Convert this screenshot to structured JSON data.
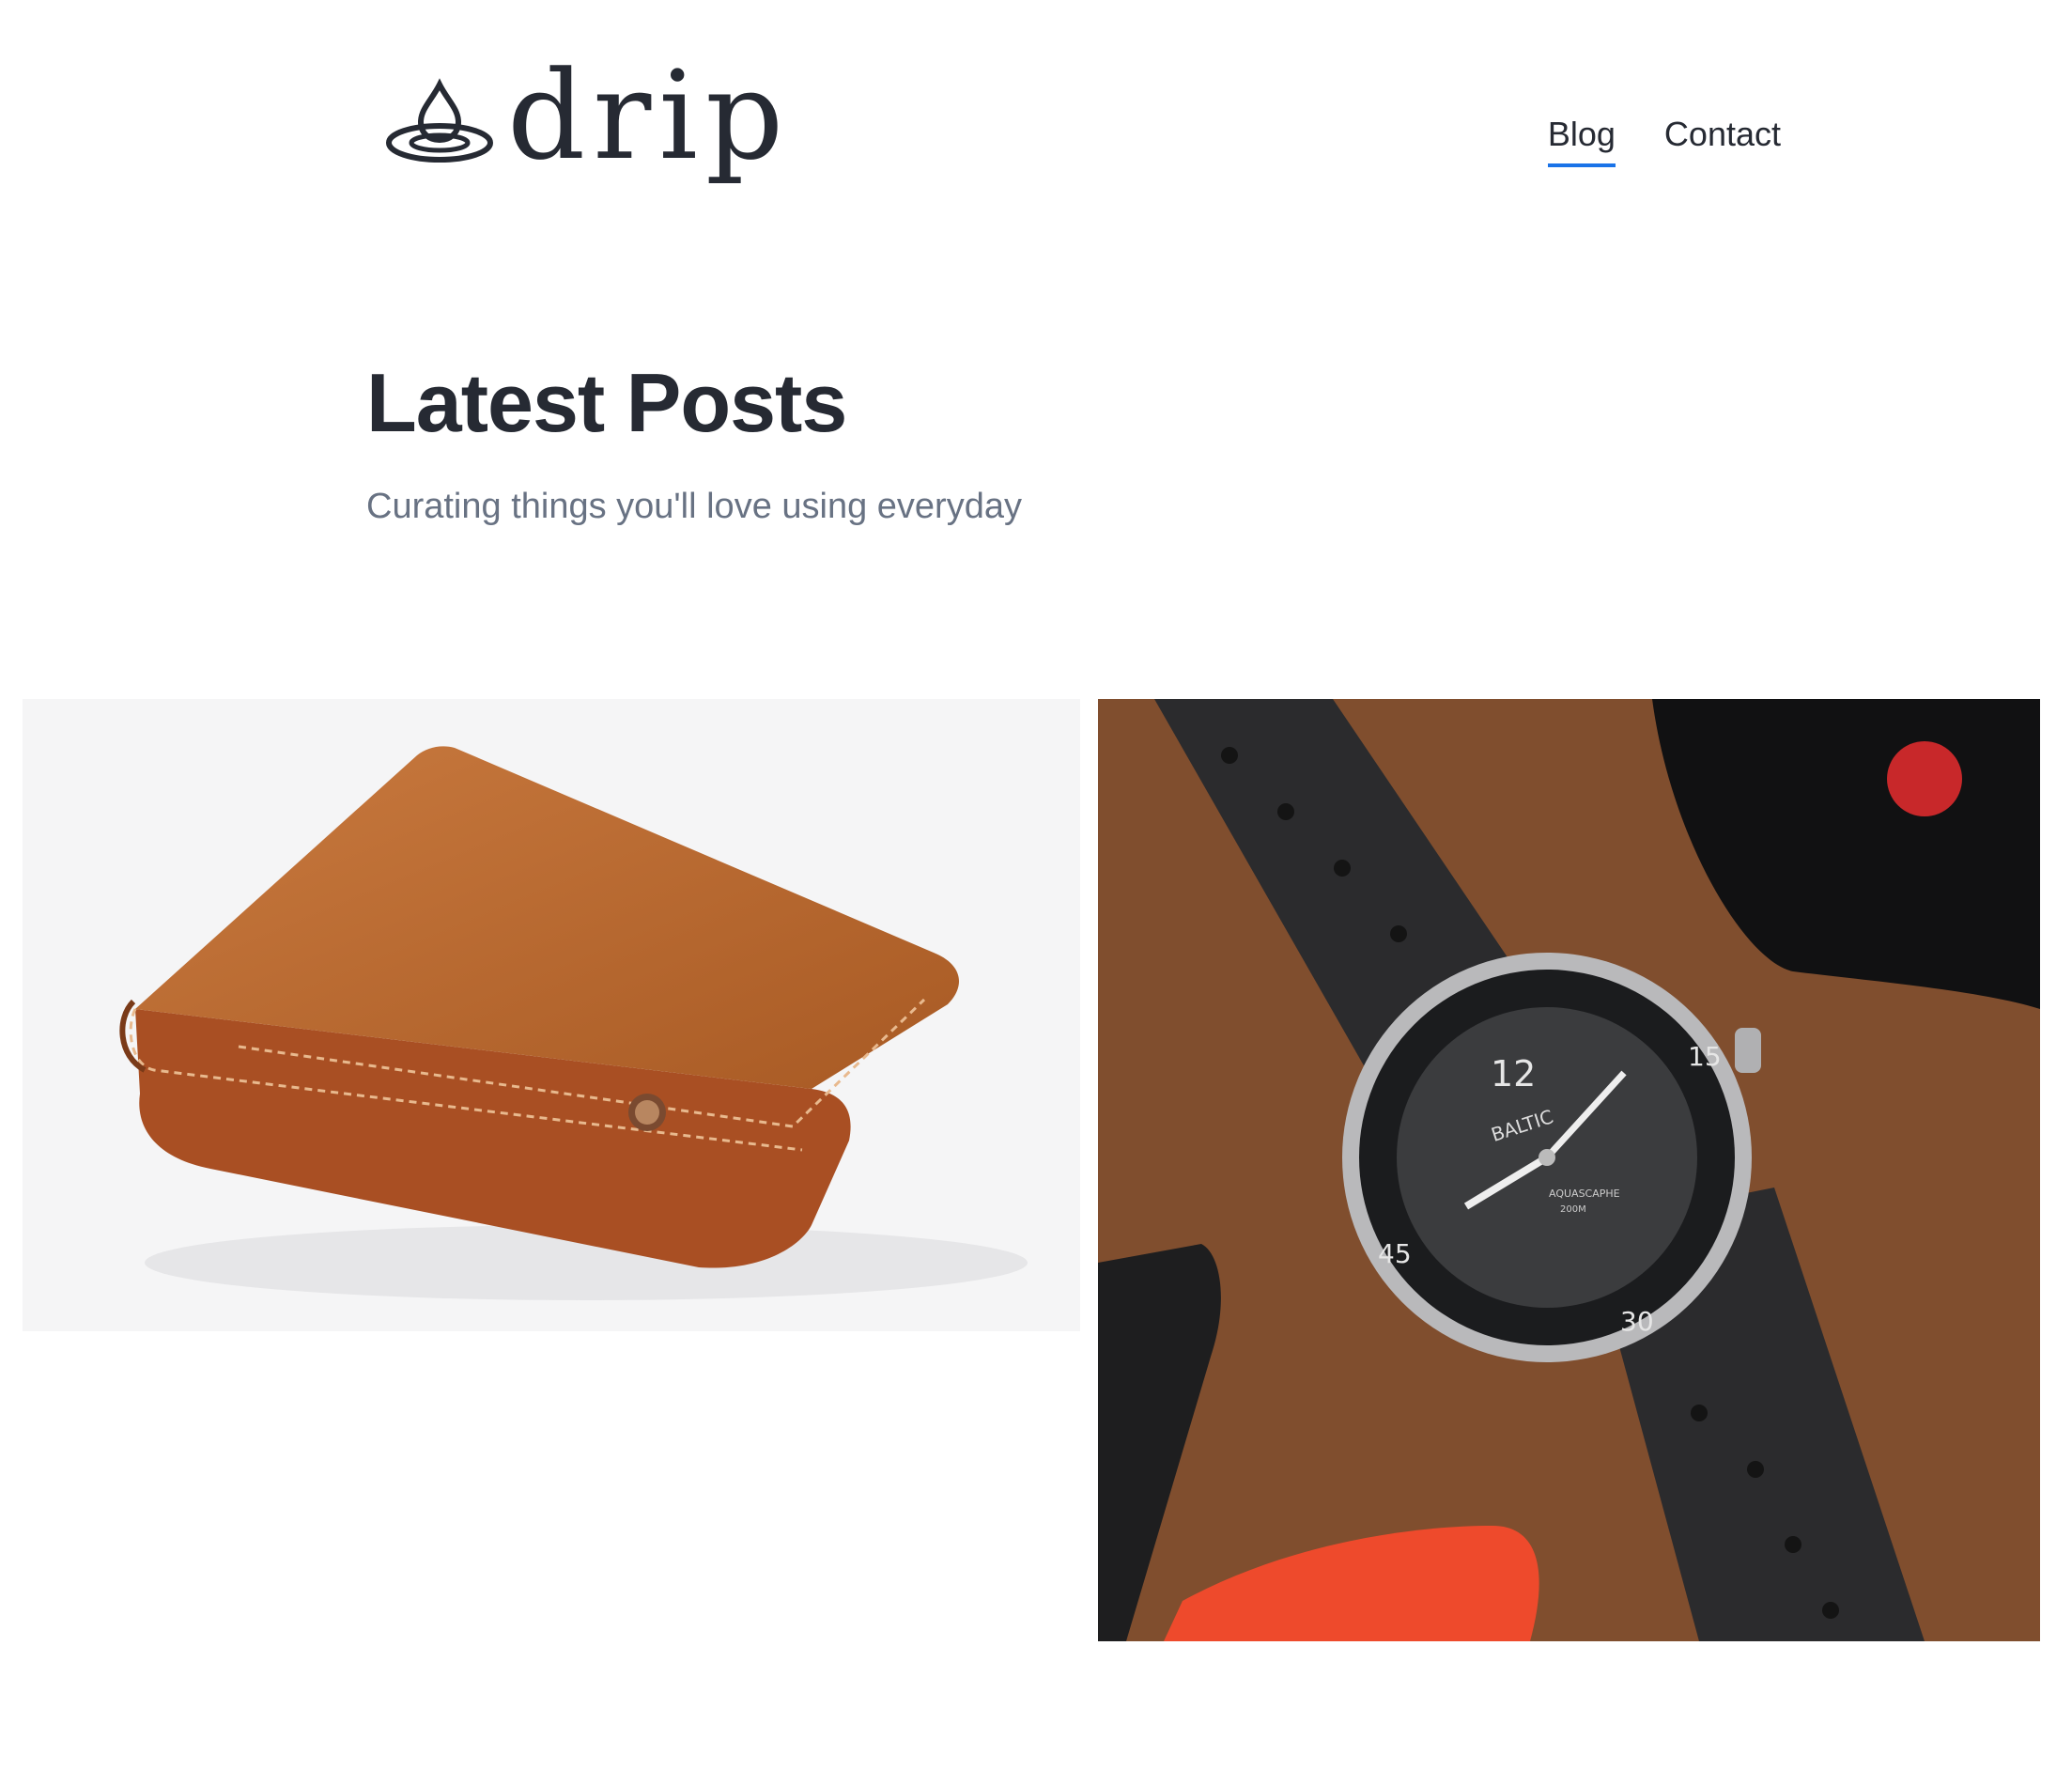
{
  "brand": {
    "name": "drip"
  },
  "nav": {
    "items": [
      {
        "label": "Blog",
        "active": true
      },
      {
        "label": "Contact",
        "active": false
      }
    ],
    "accent": "#1a73e8"
  },
  "hero": {
    "title": "Latest Posts",
    "subtitle": "Curating things you'll love using everyday"
  },
  "posts": [
    {
      "image": "leather-wallet",
      "image_bg": "#f5f5f6"
    },
    {
      "image": "dive-watch",
      "image_bg": "#7a4a2c",
      "watch": {
        "brand": "BALTIC",
        "model": "AQUASCAPHE",
        "depth": "200M",
        "bezel": [
          "15",
          "30",
          "45"
        ],
        "dial": "12"
      }
    }
  ]
}
